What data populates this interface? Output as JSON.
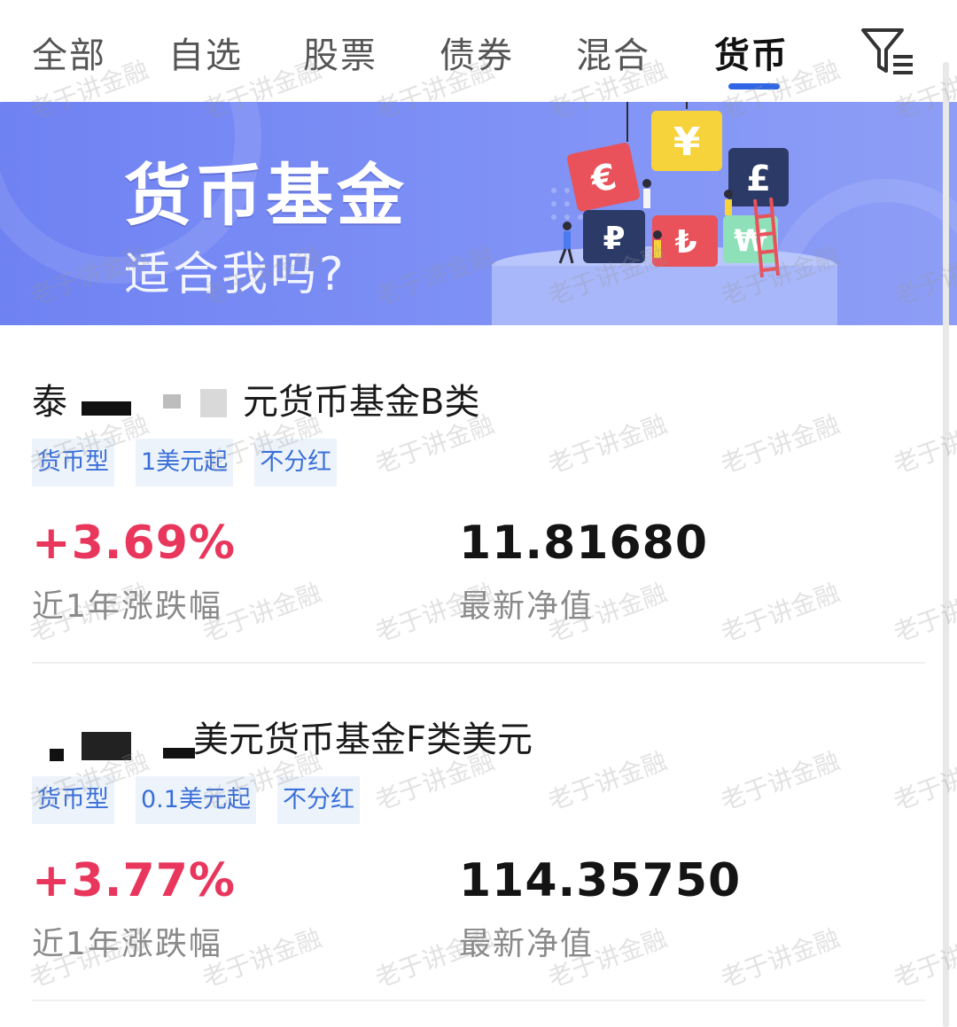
{
  "tabs": [
    {
      "label": "全部",
      "active": false
    },
    {
      "label": "自选",
      "active": false
    },
    {
      "label": "股票",
      "active": false
    },
    {
      "label": "债券",
      "active": false
    },
    {
      "label": "混合",
      "active": false
    },
    {
      "label": "货币",
      "active": true
    }
  ],
  "filter_icon": "filter-list-icon",
  "banner": {
    "title": "货币基金",
    "subtitle": "适合我吗?",
    "art_icons": [
      "euro-puzzle-icon",
      "yen-puzzle-icon",
      "pound-puzzle-icon",
      "ruble-puzzle-icon",
      "lira-puzzle-icon",
      "won-puzzle-icon"
    ]
  },
  "funds": [
    {
      "name_prefix": "泰",
      "name_suffix": "元货币基金B类",
      "tags": [
        "货币型",
        "1美元起",
        "不分红"
      ],
      "return_value": "+3.69%",
      "return_label": "近1年涨跌幅",
      "nav_value": "11.81680",
      "nav_label": "最新净值"
    },
    {
      "name_prefix": "",
      "name_suffix": "美元货币基金F类美元",
      "tags": [
        "货币型",
        "0.1美元起",
        "不分红"
      ],
      "return_value": "+3.77%",
      "return_label": "近1年涨跌幅",
      "nav_value": "114.35750",
      "nav_label": "最新净值"
    }
  ],
  "watermark": "老于讲金融",
  "colors": {
    "accent": "#2f66e6",
    "rise": "#e8365c",
    "tag_bg": "#edf3fb",
    "tag_text": "#3a6fd8",
    "banner": "#7c8ff5"
  }
}
